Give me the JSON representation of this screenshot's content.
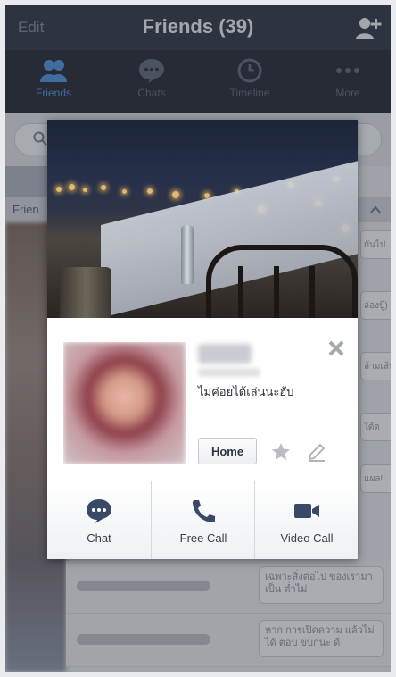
{
  "header": {
    "edit_label": "Edit",
    "title": "Friends (39)"
  },
  "tabs": [
    {
      "label": "Friends",
      "icon": "friends-icon",
      "active": true
    },
    {
      "label": "Chats",
      "icon": "chat-bubble-icon",
      "active": false
    },
    {
      "label": "Timeline",
      "icon": "clock-icon",
      "active": false
    },
    {
      "label": "More",
      "icon": "more-dots-icon",
      "active": false
    }
  ],
  "background": {
    "section_label": "Frien",
    "messages": [
      "เฉพาะสิ่งต่อไป ของเรามาเป็น ต่ำไม่",
      "หาก การเปิดความ แล้วไม่ได้ ตอบ ขบกนะ ดี"
    ],
    "status_strips": [
      "กันไป",
      "ล่องปู้)",
      "ล้ามเส้น",
      "ใด้ด",
      "แผล!!"
    ]
  },
  "profile": {
    "status_message": "ไม่ค่อยได้เล่นนะฮับ",
    "home_label": "Home"
  },
  "actions": [
    {
      "label": "Chat",
      "icon": "chat-bubble-icon"
    },
    {
      "label": "Free Call",
      "icon": "phone-icon"
    },
    {
      "label": "Video Call",
      "icon": "video-camera-icon"
    }
  ],
  "colors": {
    "accent": "#4f8fd8",
    "titlebar": "#313a48",
    "tabbar": "#252c38",
    "action_icon": "#3a4a66"
  }
}
